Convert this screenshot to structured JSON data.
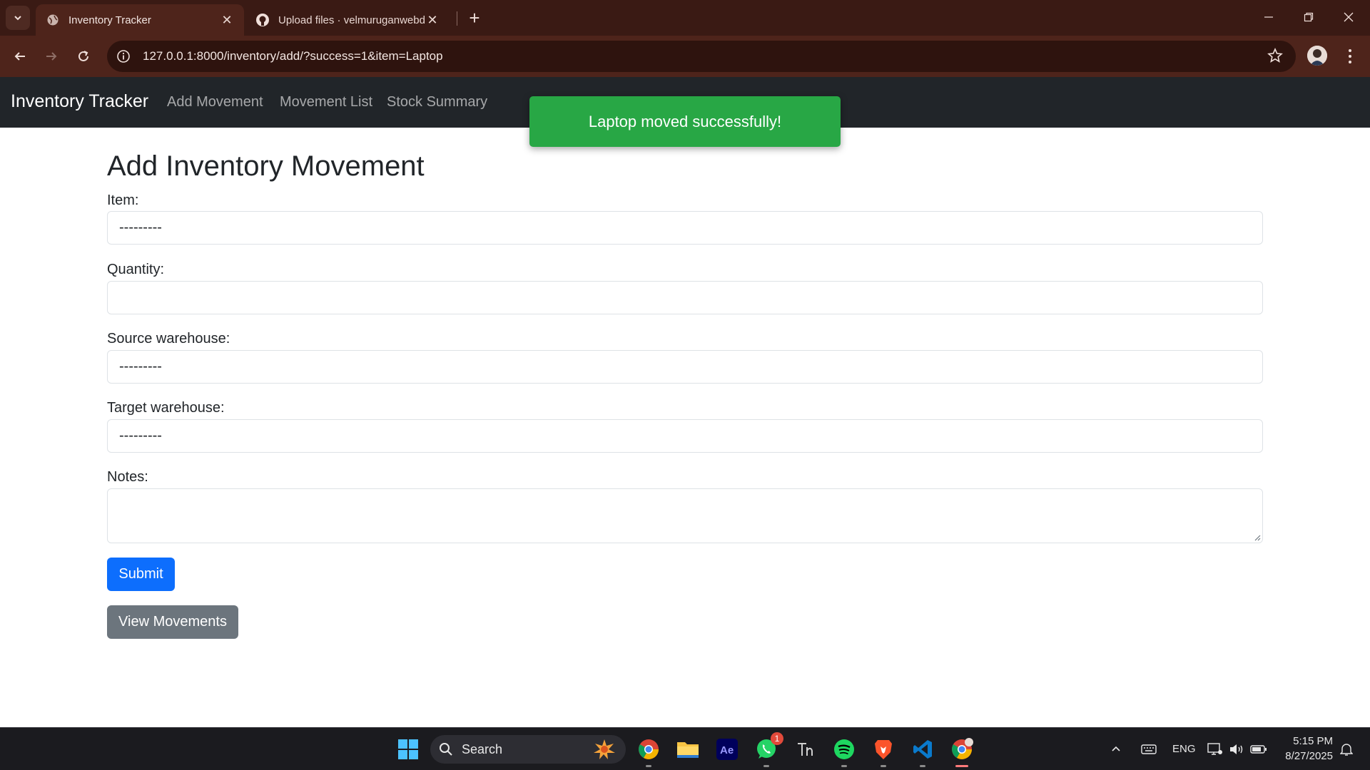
{
  "browser": {
    "tabs": [
      {
        "title": "Inventory Tracker",
        "active": true
      },
      {
        "title": "Upload files · velmuruganwebdev",
        "active": false
      }
    ],
    "url": "127.0.0.1:8000/inventory/add/?success=1&item=Laptop"
  },
  "navbar": {
    "brand": "Inventory Tracker",
    "links": [
      "Add Movement",
      "Movement List",
      "Stock Summary"
    ]
  },
  "toast": {
    "message": "Laptop moved successfully!",
    "color": "#28a745"
  },
  "form": {
    "title": "Add Inventory Movement",
    "item_label": "Item:",
    "item_value": "---------",
    "quantity_label": "Quantity:",
    "quantity_value": "",
    "source_label": "Source warehouse:",
    "source_value": "---------",
    "target_label": "Target warehouse:",
    "target_value": "---------",
    "notes_label": "Notes:",
    "notes_value": "",
    "submit_label": "Submit",
    "view_label": "View Movements"
  },
  "taskbar": {
    "search_label": "Search",
    "whatsapp_badge": "1",
    "language": "ENG",
    "time": "5:15 PM",
    "date": "8/27/2025"
  }
}
